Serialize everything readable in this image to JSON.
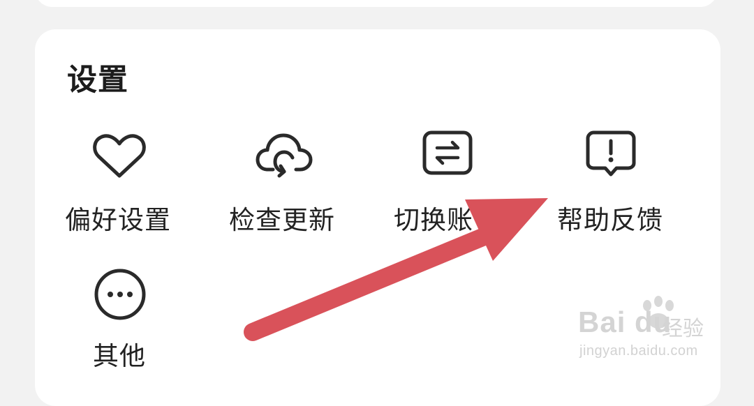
{
  "section": {
    "title": "设置"
  },
  "items": [
    {
      "label": "偏好设置",
      "icon": "heart-icon"
    },
    {
      "label": "检查更新",
      "icon": "cloud-refresh-icon"
    },
    {
      "label": "切换账",
      "icon": "switch-account-icon"
    },
    {
      "label": "帮助反馈",
      "icon": "feedback-icon"
    },
    {
      "label": "其他",
      "icon": "more-icon"
    }
  ],
  "watermark": {
    "brand": "Bai du",
    "suffix": "经验",
    "url": "jingyan.baidu.com"
  },
  "colors": {
    "arrow": "#d9525a",
    "icon_stroke": "#2a2a2a",
    "card": "#ffffff",
    "background": "#f2f2f2"
  }
}
